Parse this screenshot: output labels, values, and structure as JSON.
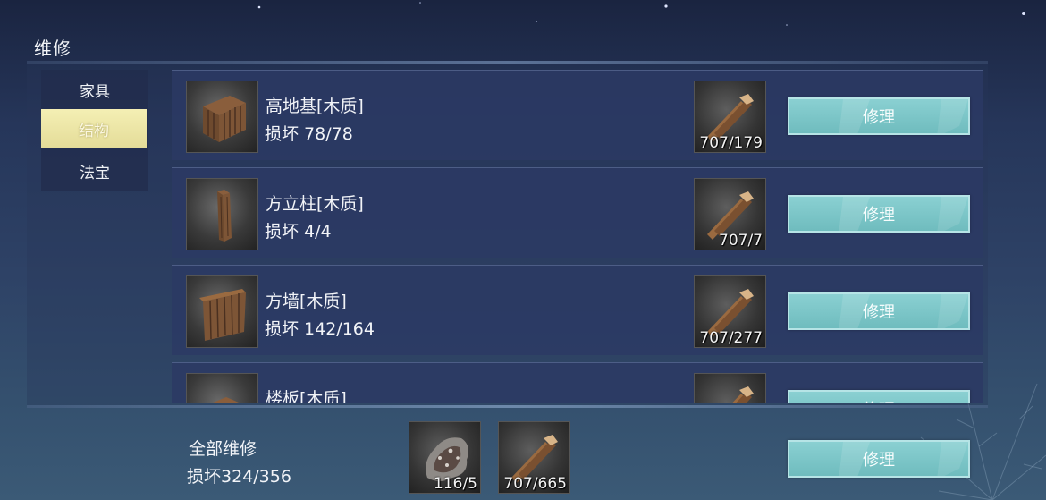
{
  "window": {
    "title": "维修"
  },
  "sidebar": {
    "items": [
      {
        "label": "家具",
        "active": false
      },
      {
        "label": "结构",
        "active": true
      },
      {
        "label": "法宝",
        "active": false
      }
    ]
  },
  "rows": [
    {
      "name": "高地基[木质]",
      "damage": "损坏 78/78",
      "item_icon": "wooden-crate-foundation-icon",
      "material_icon": "wood-plank-icon",
      "material_qty": "707/179",
      "button": "修理"
    },
    {
      "name": "方立柱[木质]",
      "damage": "损坏 4/4",
      "item_icon": "wooden-pillar-icon",
      "material_icon": "wood-plank-icon",
      "material_qty": "707/7",
      "button": "修理"
    },
    {
      "name": "方墙[木质]",
      "damage": "损坏 142/164",
      "item_icon": "wooden-wall-icon",
      "material_icon": "wood-plank-icon",
      "material_qty": "707/277",
      "button": "修理"
    },
    {
      "name": "楼板[木质]",
      "damage": "",
      "item_icon": "wooden-floor-icon",
      "material_icon": "wood-plank-icon",
      "material_qty": "",
      "button": "修理"
    }
  ],
  "footer": {
    "label": "全部维修",
    "damage": "损坏324/356",
    "materials": [
      {
        "icon": "animal-hide-icon",
        "qty": "116/5"
      },
      {
        "icon": "wood-plank-icon",
        "qty": "707/665"
      }
    ],
    "button": "修理"
  },
  "colors": {
    "button": "#7cc6c8",
    "button_border": "#b6e4e6",
    "active_tab": "#ece5a6",
    "row_bg": "#2c3a64"
  }
}
